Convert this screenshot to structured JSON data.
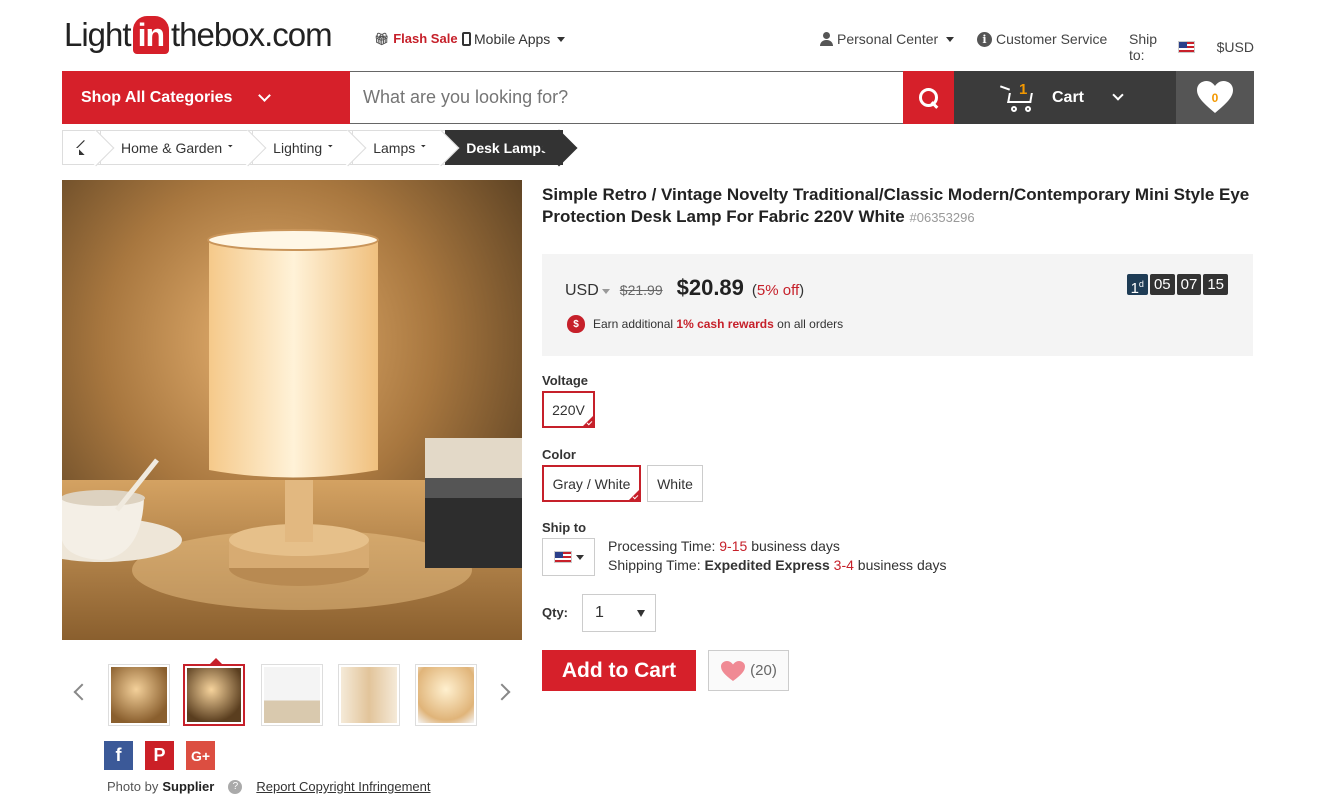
{
  "header": {
    "logo": {
      "pre": "Light",
      "mid": "in",
      "post": "thebox.com"
    },
    "flash_sale": "Flash Sale",
    "mobile_apps": "Mobile Apps",
    "personal_center": "Personal Center",
    "customer_service": "Customer Service",
    "ship_to_label": "Ship to:",
    "currency": "$USD"
  },
  "searchbar": {
    "shop_all": "Shop All Categories",
    "placeholder": "What are you looking for?",
    "cart_label": "Cart",
    "cart_count": "1",
    "wishlist_count": "0"
  },
  "breadcrumb": {
    "items": [
      "Home & Garden",
      "Lighting",
      "Lamps"
    ],
    "current": "Desk Lamps"
  },
  "product": {
    "title": "Simple Retro / Vintage Novelty Traditional/Classic Modern/Contemporary Mini Style Eye Protection Desk Lamp For Fabric 220V White",
    "sku": "#06353296",
    "currency": "USD",
    "old_price": "$21.99",
    "price": "$20.89",
    "discount_open": "(",
    "discount_value": "5% off",
    "discount_close": ")",
    "countdown": {
      "days": "1",
      "day_unit": "d",
      "h": "05",
      "m": "07",
      "s": "15"
    },
    "cash_prefix": "Earn additional",
    "cash_highlight": "1% cash rewards",
    "cash_suffix": "on all orders",
    "voltage_label": "Voltage",
    "voltage_options": [
      "220V"
    ],
    "color_label": "Color",
    "color_options": [
      "Gray / White",
      "White"
    ],
    "ship_label": "Ship to",
    "processing_prefix": "Processing Time:",
    "processing_value": "9-15",
    "processing_suffix": "business days",
    "shipping_prefix": "Shipping Time:",
    "shipping_method": "Expedited Express",
    "shipping_value": "3-4",
    "shipping_suffix": "business days",
    "qty_label": "Qty:",
    "qty_value": "1",
    "add_to_cart": "Add to Cart",
    "wish_count": "(20)"
  },
  "gallery": {
    "photo_by": "Photo by",
    "supplier": "Supplier",
    "report": "Report Copyright Infringement",
    "social": [
      "f",
      "P",
      "G+"
    ]
  },
  "colors": {
    "brand_red": "#d6202a",
    "dark": "#3b3b3b"
  }
}
